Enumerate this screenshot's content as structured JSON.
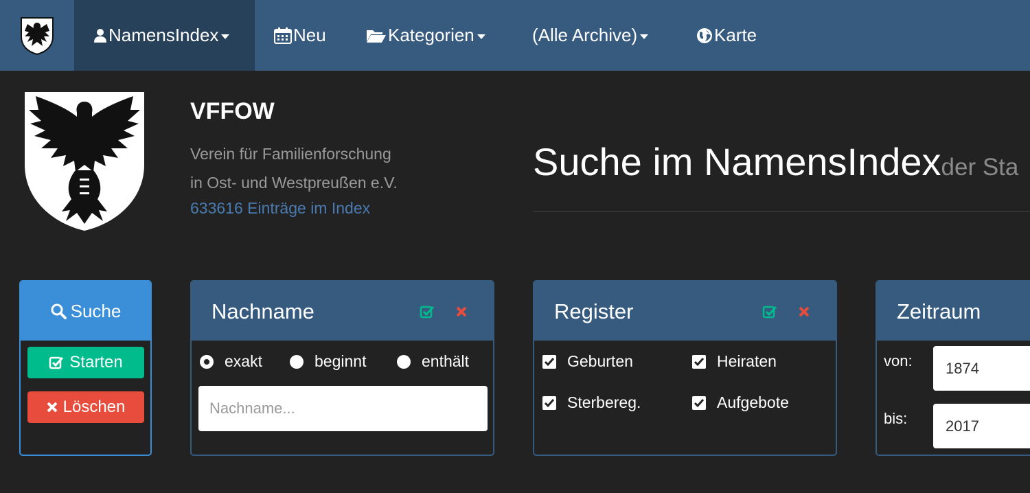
{
  "nav": {
    "items": [
      {
        "label": "NamensIndex",
        "icon": "user-icon",
        "dropdown": true,
        "active": true
      },
      {
        "label": "Neu",
        "icon": "calendar-icon",
        "dropdown": false
      },
      {
        "label": "Kategorien",
        "icon": "folder-open-icon",
        "dropdown": true
      },
      {
        "label": "(Alle Archive)",
        "icon": "",
        "dropdown": true
      },
      {
        "label": "Karte",
        "icon": "globe-icon",
        "dropdown": false
      }
    ]
  },
  "header": {
    "org_name": "VFFOW",
    "org_desc_line1": "Verein für Familienforschung",
    "org_desc_line2": "in Ost- und Westpreußen e.V.",
    "entry_count": "633616 Einträge im Index",
    "title": "Suche im NamensIndex",
    "title_sub": "der Sta"
  },
  "search_panel": {
    "title": "Suche",
    "start_label": "Starten",
    "clear_label": "Löschen"
  },
  "name_panel": {
    "title": "Nachname",
    "options": [
      "exakt",
      "beginnt",
      "enthält"
    ],
    "selected": "exakt",
    "placeholder": "Nachname..."
  },
  "register_panel": {
    "title": "Register",
    "items": [
      {
        "label": "Geburten",
        "checked": true
      },
      {
        "label": "Heiraten",
        "checked": true
      },
      {
        "label": "Sterbereg.",
        "checked": true
      },
      {
        "label": "Aufgebote",
        "checked": true
      }
    ]
  },
  "time_panel": {
    "title": "Zeitraum",
    "from_label": "von:",
    "from_value": "1874",
    "to_label": "bis:",
    "to_value": "2017"
  },
  "colors": {
    "navbar": "#375a7f",
    "nav_active": "#28415b",
    "background": "#222222",
    "primary": "#3a8fd8",
    "success": "#00bc8c",
    "danger": "#e74c3c",
    "link": "#4a7bb0"
  }
}
